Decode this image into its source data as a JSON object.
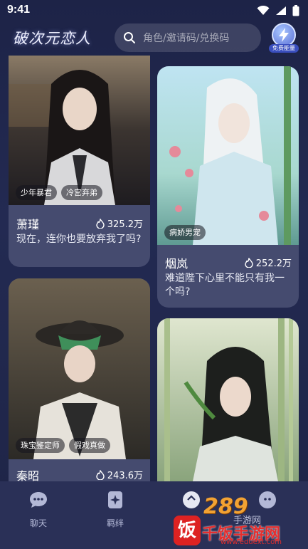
{
  "status": {
    "time": "9:41"
  },
  "header": {
    "logo": "破次元恋人",
    "search_placeholder": "角色/邀请码/兑换码",
    "energy_label": "免费能量"
  },
  "cards": [
    {
      "name": "萧瑾",
      "hot": "325.2万",
      "desc": "现在，连你也要放弃我了吗?",
      "tags": [
        "少年暴君",
        "冷宫弃弟"
      ]
    },
    {
      "name": "烟岚",
      "hot": "252.2万",
      "desc": "难道陛下心里不能只有我一个吗?",
      "tags": [
        "病娇男宠"
      ]
    },
    {
      "name": "秦昭",
      "hot": "243.6万",
      "desc": "",
      "tags": [
        "珠宝鉴定师",
        "假戏真做"
      ]
    },
    {
      "name": "",
      "hot": "",
      "desc": "",
      "tags": []
    }
  ],
  "nav": {
    "chat": "聊天",
    "bond": "羁绊",
    "third": ""
  },
  "watermark": {
    "main": "289",
    "sub": "手游网",
    "name": "千饭手游网",
    "url": "www.eduext.com",
    "badge": "饭"
  },
  "colors": {
    "bg": "#1f2548",
    "card": "#454b6f",
    "nav": "#2a3057",
    "accent": "#f2a233"
  }
}
